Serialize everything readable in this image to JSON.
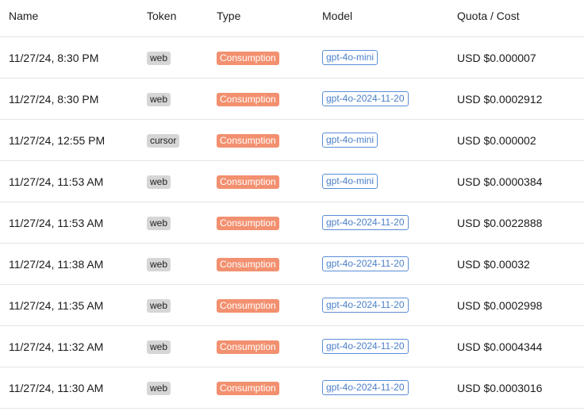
{
  "columns": {
    "name": "Name",
    "token": "Token",
    "type": "Type",
    "model": "Model",
    "cost": "Quota / Cost"
  },
  "rows": [
    {
      "time": "11/27/24, 8:30 PM",
      "token": "web",
      "type": "Consumption",
      "model": "gpt-4o-mini",
      "cost": "USD $0.000007"
    },
    {
      "time": "11/27/24, 8:30 PM",
      "token": "web",
      "type": "Consumption",
      "model": "gpt-4o-2024-11-20",
      "cost": "USD $0.0002912"
    },
    {
      "time": "11/27/24, 12:55 PM",
      "token": "cursor",
      "type": "Consumption",
      "model": "gpt-4o-mini",
      "cost": "USD $0.000002"
    },
    {
      "time": "11/27/24, 11:53 AM",
      "token": "web",
      "type": "Consumption",
      "model": "gpt-4o-mini",
      "cost": "USD $0.0000384"
    },
    {
      "time": "11/27/24, 11:53 AM",
      "token": "web",
      "type": "Consumption",
      "model": "gpt-4o-2024-11-20",
      "cost": "USD $0.0022888"
    },
    {
      "time": "11/27/24, 11:38 AM",
      "token": "web",
      "type": "Consumption",
      "model": "gpt-4o-2024-11-20",
      "cost": "USD $0.00032"
    },
    {
      "time": "11/27/24, 11:35 AM",
      "token": "web",
      "type": "Consumption",
      "model": "gpt-4o-2024-11-20",
      "cost": "USD $0.0002998"
    },
    {
      "time": "11/27/24, 11:32 AM",
      "token": "web",
      "type": "Consumption",
      "model": "gpt-4o-2024-11-20",
      "cost": "USD $0.0004344"
    },
    {
      "time": "11/27/24, 11:30 AM",
      "token": "web",
      "type": "Consumption",
      "model": "gpt-4o-2024-11-20",
      "cost": "USD $0.0003016"
    }
  ],
  "colors": {
    "type_badge_bg": "#f2906f",
    "token_badge_bg": "#d6d6d6",
    "model_badge": "#4a7fc8"
  }
}
